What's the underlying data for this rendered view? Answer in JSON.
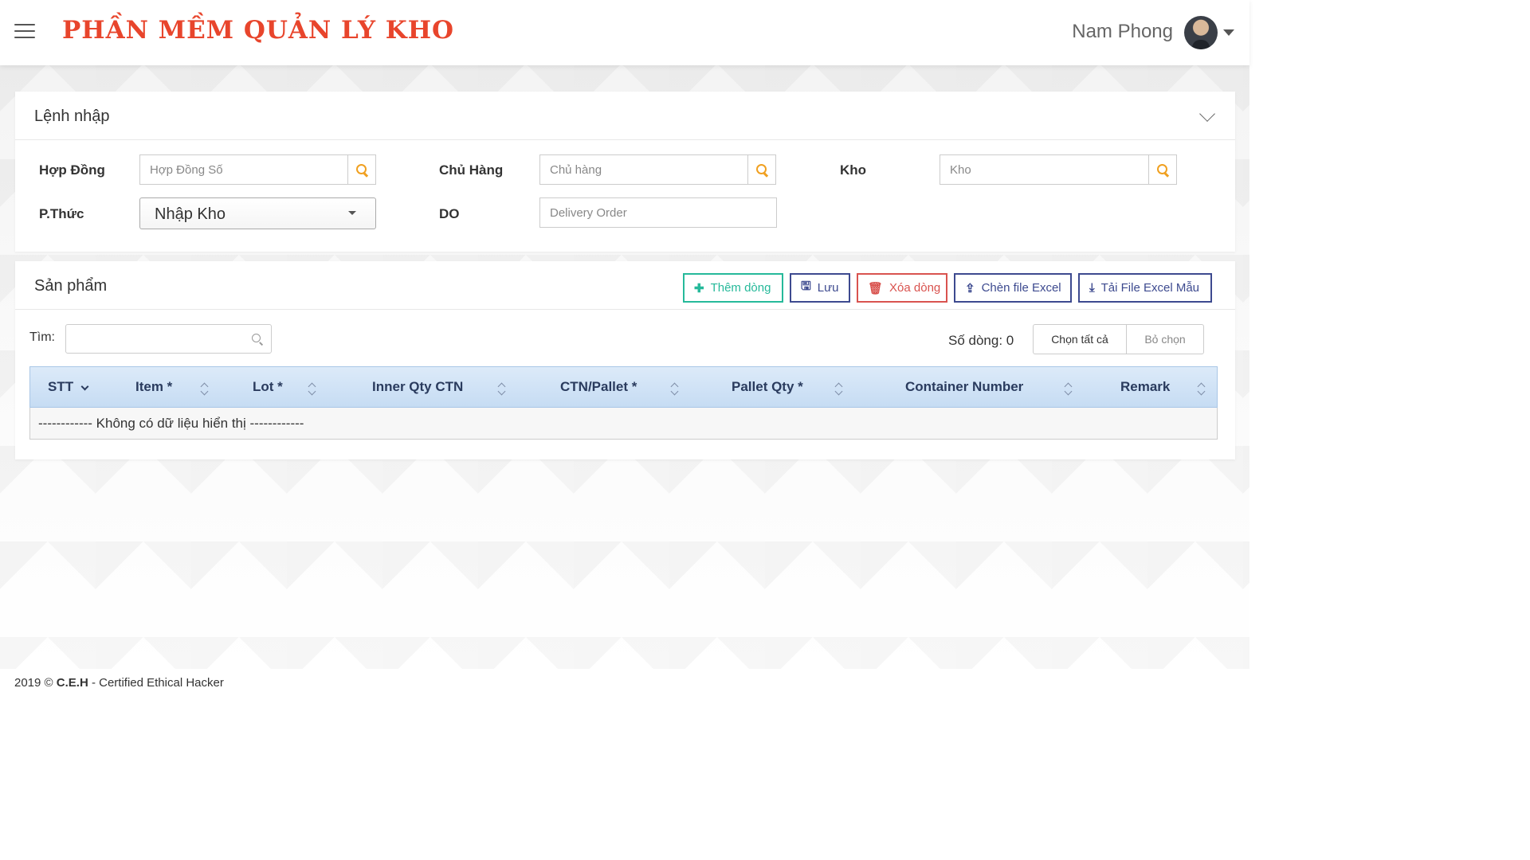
{
  "header": {
    "app_title": "PHẦN MỀM QUẢN LÝ KHO",
    "user_name": "Nam Phong"
  },
  "import_panel": {
    "title": "Lệnh nhập",
    "fields": {
      "contract": {
        "label": "Hợp Đồng",
        "placeholder": "Hợp Đồng Số",
        "value": ""
      },
      "owner": {
        "label": "Chủ Hàng",
        "placeholder": "Chủ hàng",
        "value": ""
      },
      "warehouse": {
        "label": "Kho",
        "placeholder": "Kho",
        "value": ""
      },
      "method": {
        "label": "P.Thức",
        "selected": "Nhập Kho"
      },
      "do": {
        "label": "DO",
        "placeholder": "Delivery Order",
        "value": ""
      }
    }
  },
  "product_panel": {
    "title": "Sản phẩm",
    "toolbar": {
      "add_row": "Thêm dòng",
      "save": "Lưu",
      "delete_row": "Xóa dòng",
      "insert_excel": "Chèn file Excel",
      "download_template": "Tải File Excel Mẫu"
    },
    "search": {
      "label": "Tìm:",
      "value": ""
    },
    "row_count": "Số dòng: 0",
    "select_all": "Chọn tất cả",
    "deselect": "Bỏ chọn",
    "table": {
      "columns": [
        "STT",
        "Item *",
        "Lot *",
        "Inner Qty CTN",
        "CTN/Pallet *",
        "Pallet Qty *",
        "Container Number",
        "Remark"
      ],
      "rows": [],
      "empty_text": "------------ Không có dữ liệu hiển thị ------------"
    }
  },
  "footer": {
    "year": "2019 ©",
    "brand": "C.E.H",
    "text": " - Certified Ethical Hacker"
  },
  "colors": {
    "title_red": "#e8452c",
    "search_orange": "#f0a020",
    "green": "#26b99a",
    "navy": "#3d4a8f",
    "red": "#d9534f",
    "table_header": "#c6dcf3"
  }
}
